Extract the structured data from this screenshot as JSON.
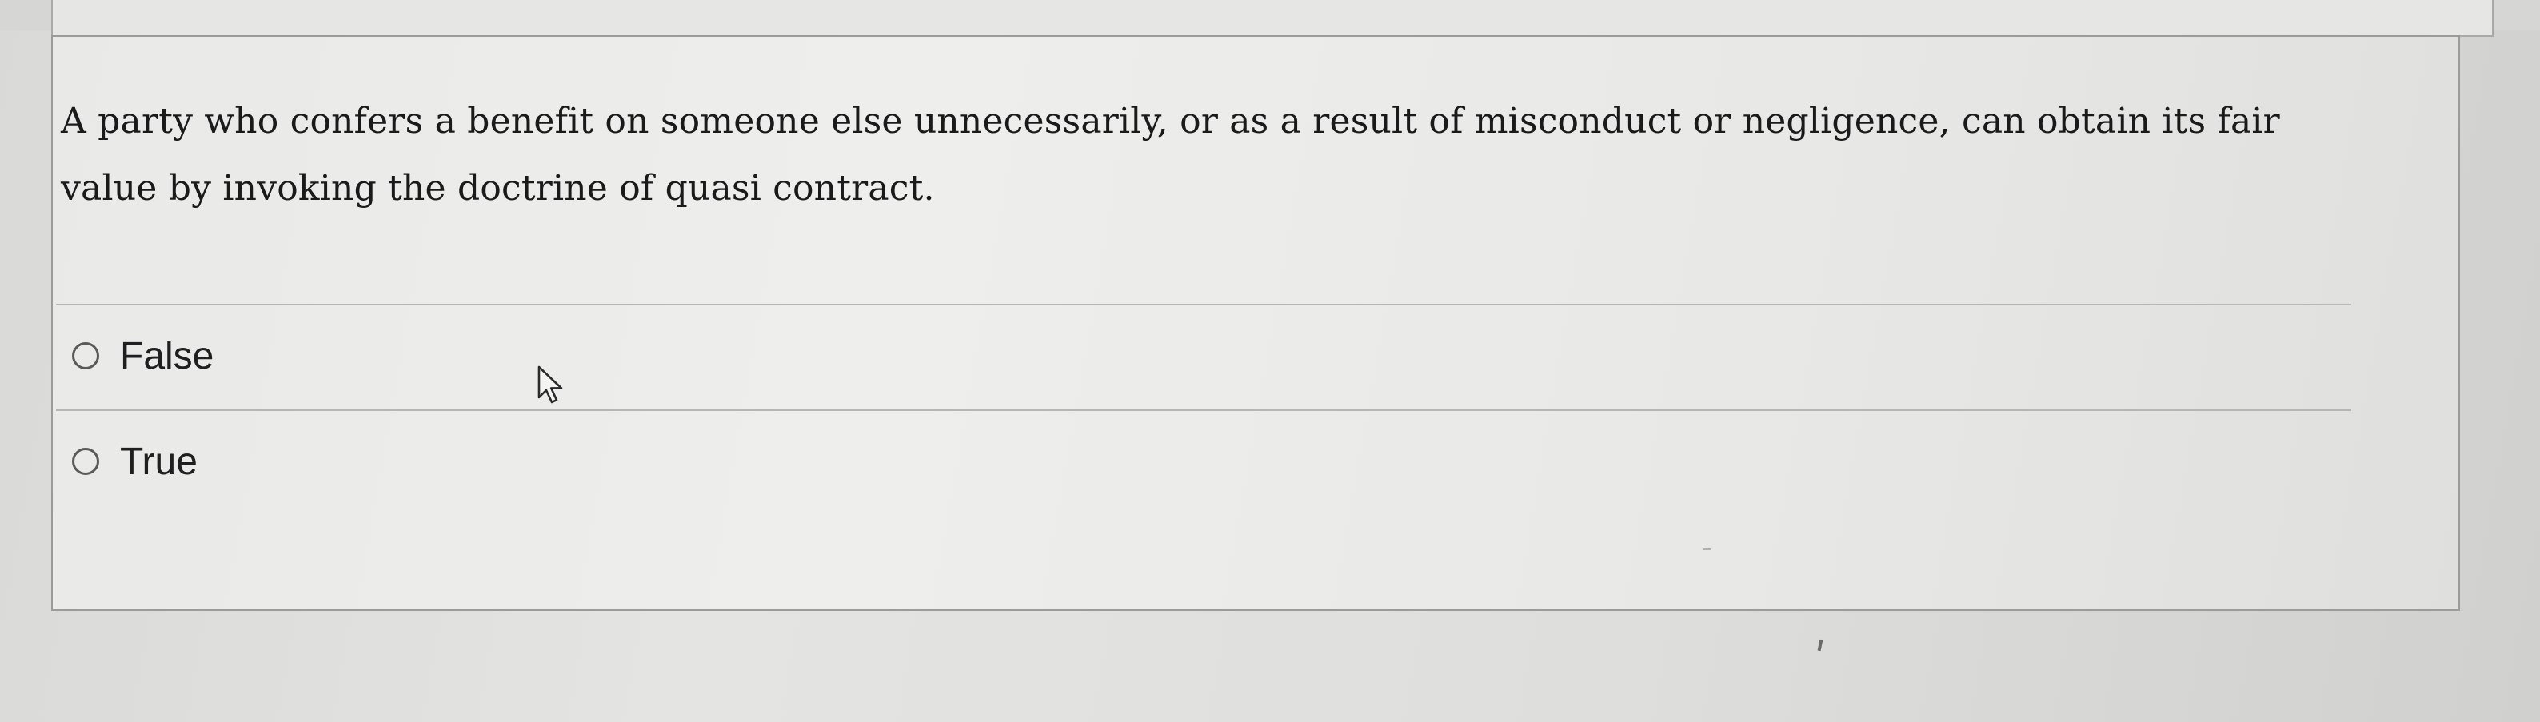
{
  "question": {
    "line_1": "A party who confers a benefit on someone else unnecessarily, or as a result of misconduct or negligence, can obtain its fair",
    "line_2": "value by invoking the doctrine of quasi contract."
  },
  "options": [
    {
      "label": "False",
      "selected": false
    },
    {
      "label": "True",
      "selected": false
    }
  ],
  "cursor": {
    "icon": "mouse-pointer-icon"
  },
  "colors": {
    "text": "#1a1a1a",
    "border": "#9b9b99",
    "radio": "#5a5a5a"
  }
}
